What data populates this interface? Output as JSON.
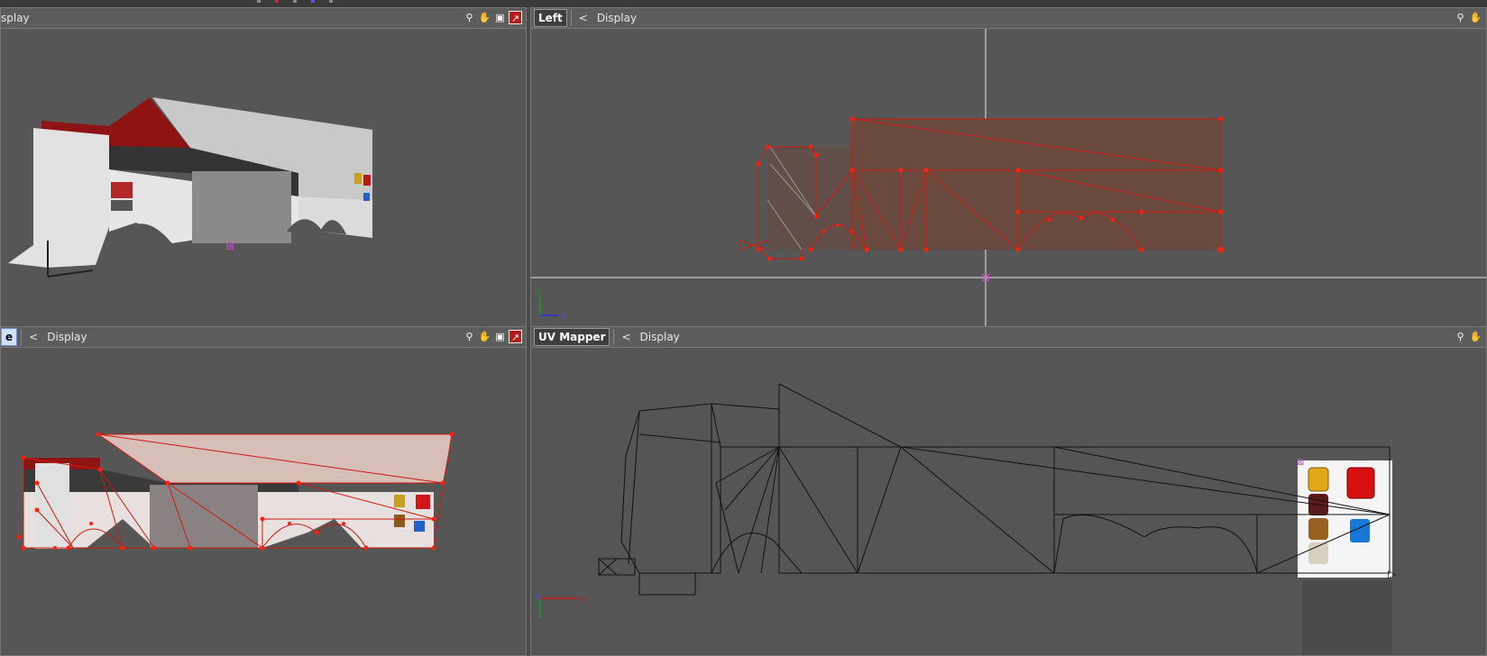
{
  "viewports": {
    "top_left": {
      "title": "",
      "display_label": "splay",
      "tools": [
        "search-icon",
        "hand-icon",
        "frame-icon",
        "maximize-icon"
      ]
    },
    "top_right": {
      "title": "Left",
      "display_label": "Display",
      "back": "<",
      "tools": [
        "search-icon",
        "hand-icon"
      ]
    },
    "bottom_left": {
      "title": "e",
      "display_label": "Display",
      "back": "<",
      "tools": [
        "search-icon",
        "hand-icon",
        "frame-icon",
        "maximize-icon"
      ]
    },
    "bottom_right": {
      "title": "UV Mapper",
      "display_label": "Display",
      "back": "<",
      "tools": [
        "search-icon",
        "hand-icon"
      ]
    }
  },
  "axes": {
    "left_view": {
      "vertical": "y",
      "horizontal": "z"
    },
    "uv_view": {
      "vertical": "z",
      "horizontal": "x"
    }
  },
  "colors": {
    "wire_red": "#cc1a10",
    "wire_black": "#111111",
    "face_fill": "#6a4a3f",
    "model_grey": "#cfcfcf"
  }
}
